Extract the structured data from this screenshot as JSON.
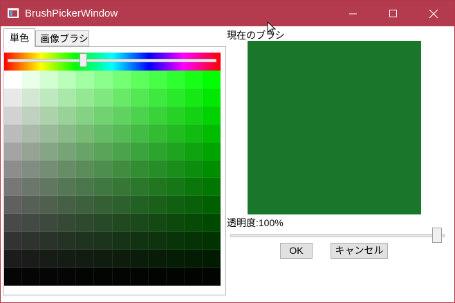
{
  "window": {
    "title": "BrushPickerWindow"
  },
  "tabs": [
    {
      "label": "単色",
      "selected": true
    },
    {
      "label": "画像ブラシ",
      "selected": false
    }
  ],
  "colors": {
    "titlebar": "#b43a4d",
    "current_brush": "#19772b",
    "hue_fraction": 0.36
  },
  "preview": {
    "label": "現在のブラシ"
  },
  "opacity": {
    "label": "透明度:100%",
    "value_percent": 100
  },
  "buttons": {
    "ok": "OK",
    "cancel": "キャンセル"
  },
  "icons": {
    "app": "window-icon",
    "minimize": "minimize-icon",
    "maximize": "maximize-icon",
    "close": "close-icon",
    "cursor": "mouse-cursor-icon"
  }
}
